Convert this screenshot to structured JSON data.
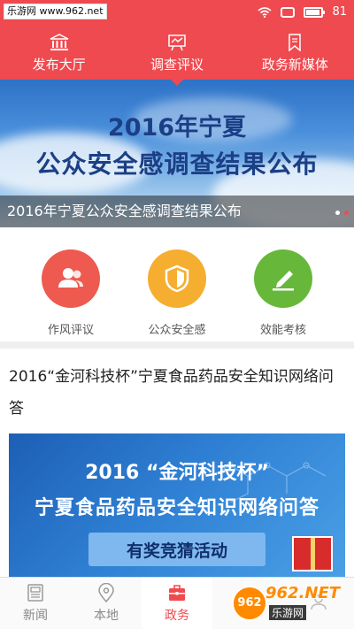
{
  "status_bar": {
    "watermark": "乐游网 www.962.net",
    "battery": "81",
    "battery_level": 0.81
  },
  "top_nav": {
    "items": [
      {
        "label": "发布大厅",
        "icon": "bank-icon"
      },
      {
        "label": "调查评议",
        "icon": "survey-board-icon"
      },
      {
        "label": "政务新媒体",
        "icon": "bookmark-icon"
      }
    ],
    "active_index": 1
  },
  "banner": {
    "title_line1": "2016年宁夏",
    "title_line2": "公众安全感调查结果公布",
    "caption": "2016年宁夏公众安全感调查结果公布",
    "slide_count": 2,
    "active_slide": 2
  },
  "quick_actions": [
    {
      "label": "作风评议",
      "icon": "users-icon",
      "color": "#ee5a4f"
    },
    {
      "label": "公众安全感",
      "icon": "shield-icon",
      "color": "#f5ae2f"
    },
    {
      "label": "效能考核",
      "icon": "edit-icon",
      "color": "#67b83a"
    }
  ],
  "article": {
    "title": "2016“金河科技杯”宁夏食品药品安全知识网络问答",
    "image_line1": "2016 “金河科技杯”",
    "image_line2": "宁夏食品药品安全知识网络问答",
    "image_line3": "有奖竞猜活动"
  },
  "tabbar": {
    "tabs": [
      {
        "label": "新闻",
        "icon": "newspaper-icon"
      },
      {
        "label": "本地",
        "icon": "location-pin-icon"
      },
      {
        "label": "政务",
        "icon": "briefcase-icon"
      },
      {
        "label": "",
        "icon": "service-icon"
      },
      {
        "label": "",
        "icon": "user-icon"
      }
    ],
    "active_index": 2
  },
  "watermark_bottom": {
    "logo": "962",
    "text1": "962.NET",
    "text2": "乐游网"
  },
  "colors": {
    "primary": "#ef4a4f",
    "banner_text": "#1b3f86"
  }
}
